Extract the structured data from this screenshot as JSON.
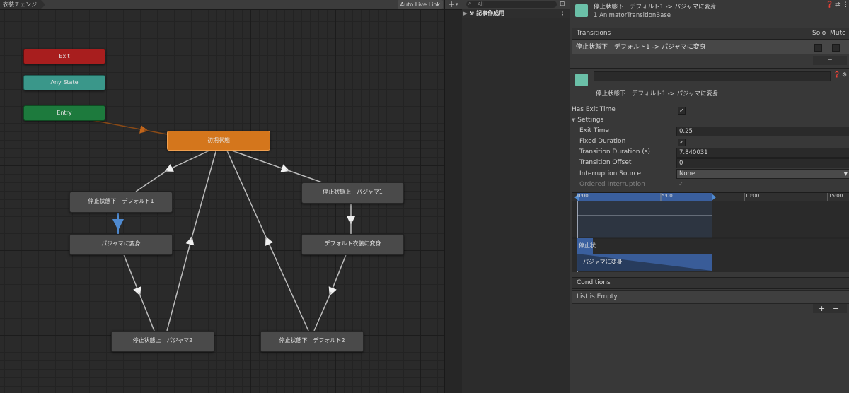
{
  "animator": {
    "breadcrumb": "衣装チェンジ",
    "auto_live_link": "Auto Live Link",
    "nodes": {
      "exit": "Exit",
      "any_state": "Any State",
      "entry": "Entry",
      "default_state": "初期状態",
      "stop_down_default1": "停止状態下　デフォルト1",
      "stop_up_pajama1": "停止状態上　パジャマ1",
      "to_pajama": "パジャマに変身",
      "to_default": "デフォルト衣装に変身",
      "stop_up_pajama2": "停止状態上　パジャマ2",
      "stop_down_default2": "停止状態下　デフォルト2"
    }
  },
  "hierarchy": {
    "add_label": "+",
    "search_placeholder": "All",
    "item": "記事作成用"
  },
  "inspector": {
    "title": "停止状態下　デフォルト1 -> パジャマに変身",
    "subtitle": "1 AnimatorTransitionBase",
    "transitions": {
      "header": "Transitions",
      "solo": "Solo",
      "mute": "Mute",
      "row": "停止状態下　デフォルト1 -> パジャマに変身",
      "remove": "−"
    },
    "transition_name_field": "",
    "transition_caption": "停止状態下　デフォルト1 -> パジャマに変身",
    "has_exit_time": {
      "label": "Has Exit Time",
      "checked": true
    },
    "settings": {
      "header": "Settings",
      "exit_time": {
        "label": "Exit Time",
        "value": "0.25"
      },
      "fixed_duration": {
        "label": "Fixed Duration",
        "checked": true
      },
      "transition_duration": {
        "label": "Transition Duration (s)",
        "value": "7.840031"
      },
      "transition_offset": {
        "label": "Transition Offset",
        "value": "0"
      },
      "interruption_source": {
        "label": "Interruption Source",
        "value": "None"
      },
      "ordered_interruption": {
        "label": "Ordered Interruption",
        "checked": true
      }
    },
    "timeline": {
      "ticks": [
        "0:00",
        "5:00",
        "10:00",
        "15:00"
      ],
      "source_clip": "停止状",
      "dest_clip": "パジャマに変身",
      "accent": "#3a5f9e"
    },
    "conditions": {
      "header": "Conditions",
      "empty": "List is Empty",
      "add": "+",
      "remove": "−"
    }
  }
}
